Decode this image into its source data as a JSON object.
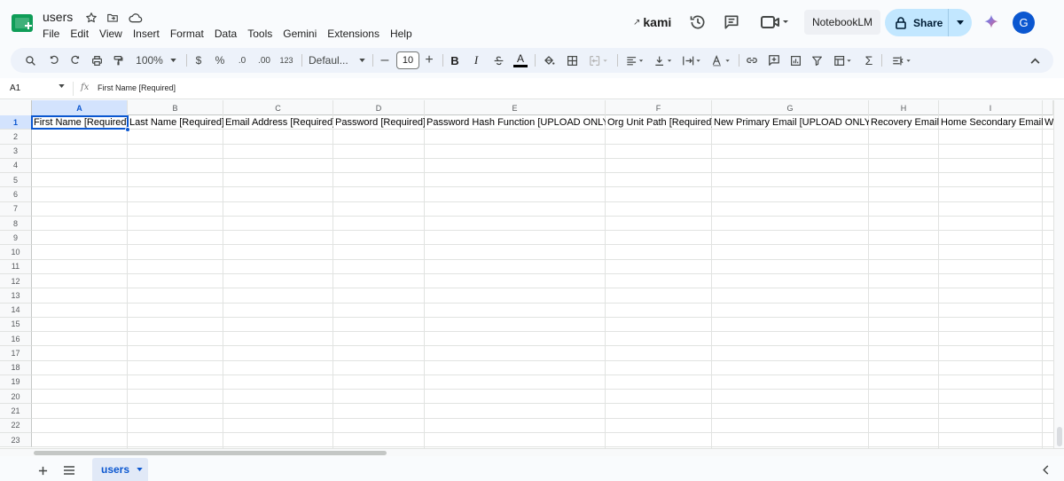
{
  "app": {
    "doc_title": "users",
    "menu": [
      "File",
      "Edit",
      "View",
      "Insert",
      "Format",
      "Data",
      "Tools",
      "Gemini",
      "Extensions",
      "Help"
    ],
    "kami_label": "kami",
    "notebooklm_label": "NotebookLM",
    "share_label": "Share",
    "avatar_letter": "G"
  },
  "toolbar": {
    "zoom": "100%",
    "currency": "$",
    "percent": "%",
    "decrease_decimal": ".0",
    "increase_decimal": ".00",
    "number_format": "123",
    "font_name": "Defaul...",
    "font_size": "10",
    "bold": "B",
    "italic": "I",
    "text_color": "A",
    "sum": "Σ"
  },
  "formula_bar": {
    "cell_ref": "A1",
    "fx": "fx",
    "content": "First Name [Required]"
  },
  "grid": {
    "columns": [
      "A",
      "B",
      "C",
      "D",
      "E",
      "F",
      "G",
      "H",
      "I"
    ],
    "rows": [
      "1",
      "2",
      "3",
      "4",
      "5",
      "6",
      "7",
      "8",
      "9",
      "10",
      "11",
      "12",
      "13",
      "14",
      "15",
      "16",
      "17",
      "18",
      "19",
      "20",
      "21",
      "22",
      "23"
    ],
    "row1": [
      "First Name [Required]",
      "Last Name [Required]",
      "Email Address [Required]",
      "Password [Required]",
      "Password Hash Function [UPLOAD ONLY]",
      "Org Unit Path [Required]",
      "New Primary Email [UPLOAD ONLY]",
      "Recovery Email",
      "Home Secondary Email",
      "Wo"
    ]
  },
  "sheets": {
    "active_tab": "users"
  },
  "colors": {
    "accent": "#0b57d0",
    "share_bg": "#c2e7ff",
    "toolbar_bg": "#edf2fa",
    "logo_green": "#0f9d58"
  }
}
